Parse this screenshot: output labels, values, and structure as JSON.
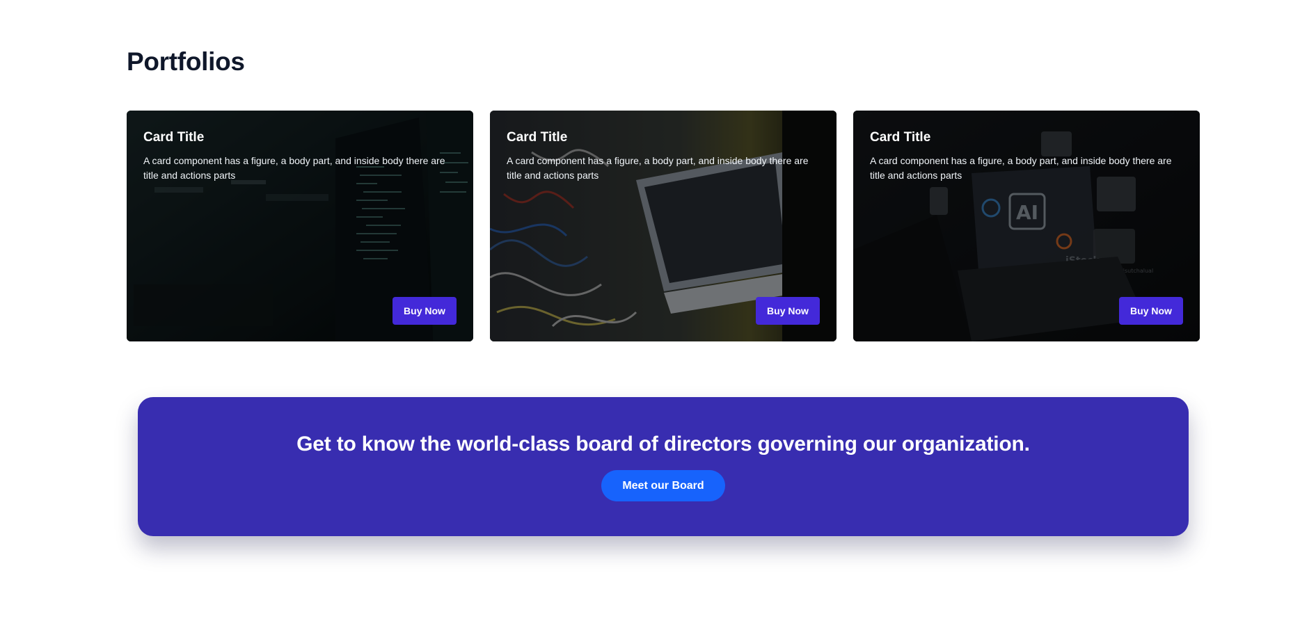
{
  "section": {
    "title": "Portfolios"
  },
  "cards": [
    {
      "title": "Card Title",
      "text": "A card component has a figure, a body part, and inside body there are title and actions parts",
      "button_label": "Buy Now",
      "image_subject": "server room code screens"
    },
    {
      "title": "Card Title",
      "text": "A card component has a figure, a body part, and inside body there are title and actions parts",
      "button_label": "Buy Now",
      "image_subject": "network cables and laptop"
    },
    {
      "title": "Card Title",
      "text": "A card component has a figure, a body part, and inside body there are title and actions parts",
      "button_label": "Buy Now",
      "image_subject": "AI dashboard laptop",
      "image_overlay_texts": [
        "AI",
        "iStock",
        "Credit: Khanchit Khirisutchalual"
      ]
    }
  ],
  "cta": {
    "heading": "Get to know the world-class board of directors governing our organization.",
    "button_label": "Meet our Board"
  },
  "colors": {
    "heading_text": "#0f172a",
    "card_button": "#4329d9",
    "cta_background": "#382db0",
    "cta_button": "#1763fc"
  }
}
